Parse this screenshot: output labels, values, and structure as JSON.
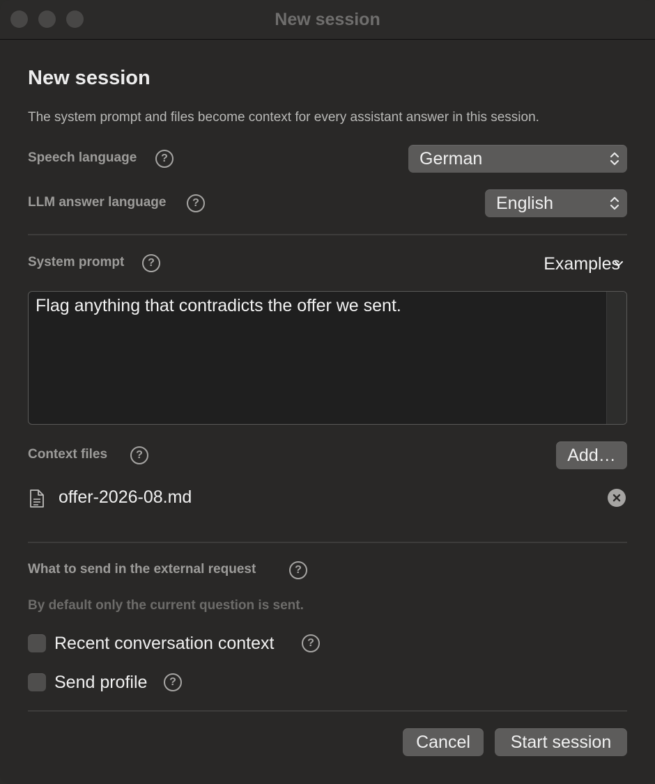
{
  "window": {
    "title": "New session"
  },
  "header": {
    "title": "New session",
    "description": "The system prompt and files become context for every assistant answer in this session."
  },
  "speech_language": {
    "label": "Speech language",
    "value": "German"
  },
  "llm_answer_language": {
    "label": "LLM answer language",
    "value": "English"
  },
  "system_prompt": {
    "label": "System prompt",
    "examples_label": "Examples",
    "value": "Flag anything that contradicts the offer we sent."
  },
  "context_files": {
    "label": "Context files",
    "add_label": "Add…",
    "files": [
      {
        "name": "offer-2026-08.md"
      }
    ]
  },
  "external_request": {
    "label": "What to send in the external request",
    "note": "By default only the current question is sent.",
    "options": [
      {
        "label": "Recent conversation context",
        "checked": false
      },
      {
        "label": "Send profile",
        "checked": false
      }
    ]
  },
  "footer": {
    "cancel_label": "Cancel",
    "start_label": "Start session"
  },
  "icons": {
    "help": "question-circle-icon",
    "file": "document-icon",
    "remove": "x-circle-icon",
    "select": "up-down-chevron-icon"
  },
  "colors": {
    "background": "#292827",
    "control": "#5b5a59",
    "text": "#f0f0f0",
    "secondary_text": "#9d9c9a"
  }
}
